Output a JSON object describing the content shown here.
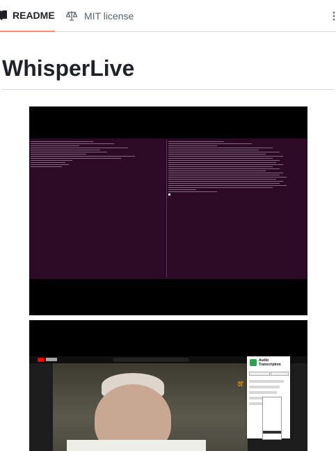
{
  "tabs": [
    {
      "label": "README",
      "icon": "book-icon",
      "active": true
    },
    {
      "label": "MIT license",
      "icon": "scale-icon",
      "active": false
    }
  ],
  "more_icon": "kebab-horizontal-icon",
  "heading": "WhisperLive",
  "accent_color": "#fd8c73",
  "images": [
    {
      "kind": "terminal-screenshot"
    },
    {
      "kind": "browser-extension-screenshot",
      "popup_title": "Audio Transcription"
    }
  ]
}
